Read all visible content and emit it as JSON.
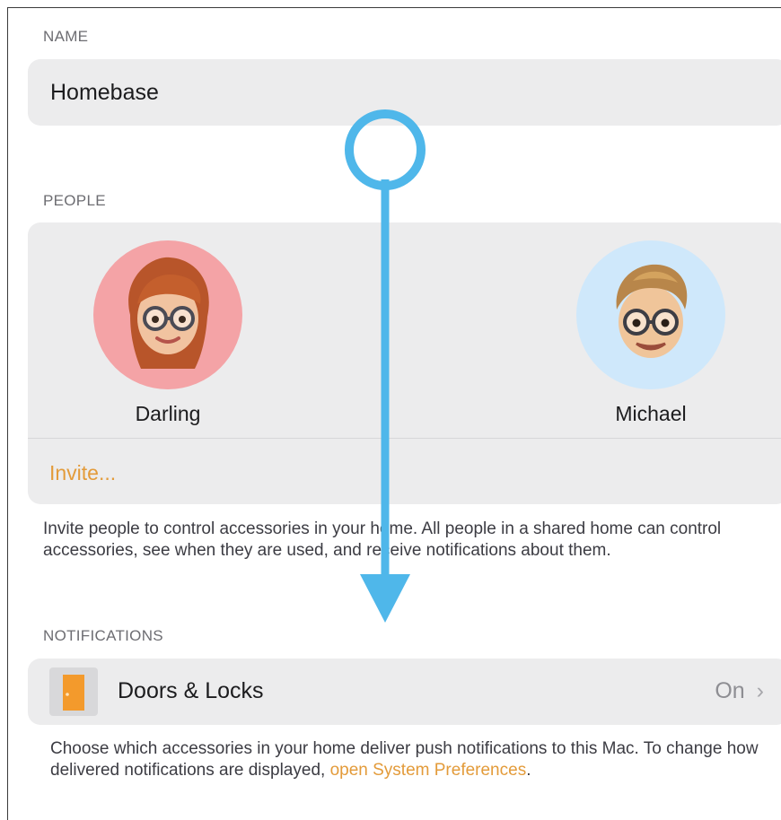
{
  "name_section": {
    "label": "NAME",
    "value": "Homebase"
  },
  "people_section": {
    "label": "PEOPLE",
    "people": [
      {
        "name": "Darling",
        "avatar_bg": "#f4a3a6"
      },
      {
        "name": "Michael",
        "avatar_bg": "#cfe8fb"
      }
    ],
    "invite_label": "Invite...",
    "footnote": "Invite people to control accessories in your home. All people in a shared home can control accessories, see when they are used, and receive notifications about them."
  },
  "notifications_section": {
    "label": "NOTIFICATIONS",
    "row": {
      "icon": "door-icon",
      "label": "Doors & Locks",
      "value": "On",
      "chevron": "›"
    },
    "footnote_text": "Choose which accessories in your home deliver push notifications to this Mac. To change how delivered notifications are displayed,",
    "footnote_link": "open System Preferences",
    "footnote_end": "."
  },
  "colors": {
    "accent": "#e39b3a",
    "gesture": "#4fb7ea",
    "group_bg": "#ececed"
  }
}
